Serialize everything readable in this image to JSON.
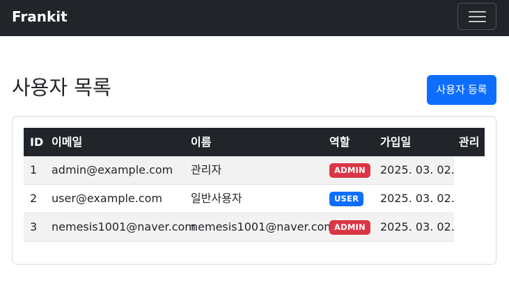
{
  "navbar": {
    "brand": "Frankit",
    "toggler_icon": "hamburger-menu-icon"
  },
  "page": {
    "title": "사용자 목록",
    "register_button": "사용자 등록"
  },
  "table": {
    "headers": {
      "id": "ID",
      "email": "이메일",
      "name": "이름",
      "role": "역할",
      "joined": "가입일",
      "manage": "관리"
    },
    "rows": [
      {
        "id": "1",
        "email": "admin@example.com",
        "name": "관리자",
        "role": "ADMIN",
        "joined": "2025. 03. 02."
      },
      {
        "id": "2",
        "email": "user@example.com",
        "name": "일반사용자",
        "role": "USER",
        "joined": "2025. 03. 02."
      },
      {
        "id": "3",
        "email": "nemesis1001@naver.com",
        "name": "nemesis1001@naver.com",
        "role": "ADMIN",
        "joined": "2025. 03. 02."
      }
    ]
  },
  "colors": {
    "navbar_bg": "#212529",
    "primary": "#0d6efd",
    "admin_badge": "#dc3545",
    "user_badge": "#0d6efd"
  }
}
